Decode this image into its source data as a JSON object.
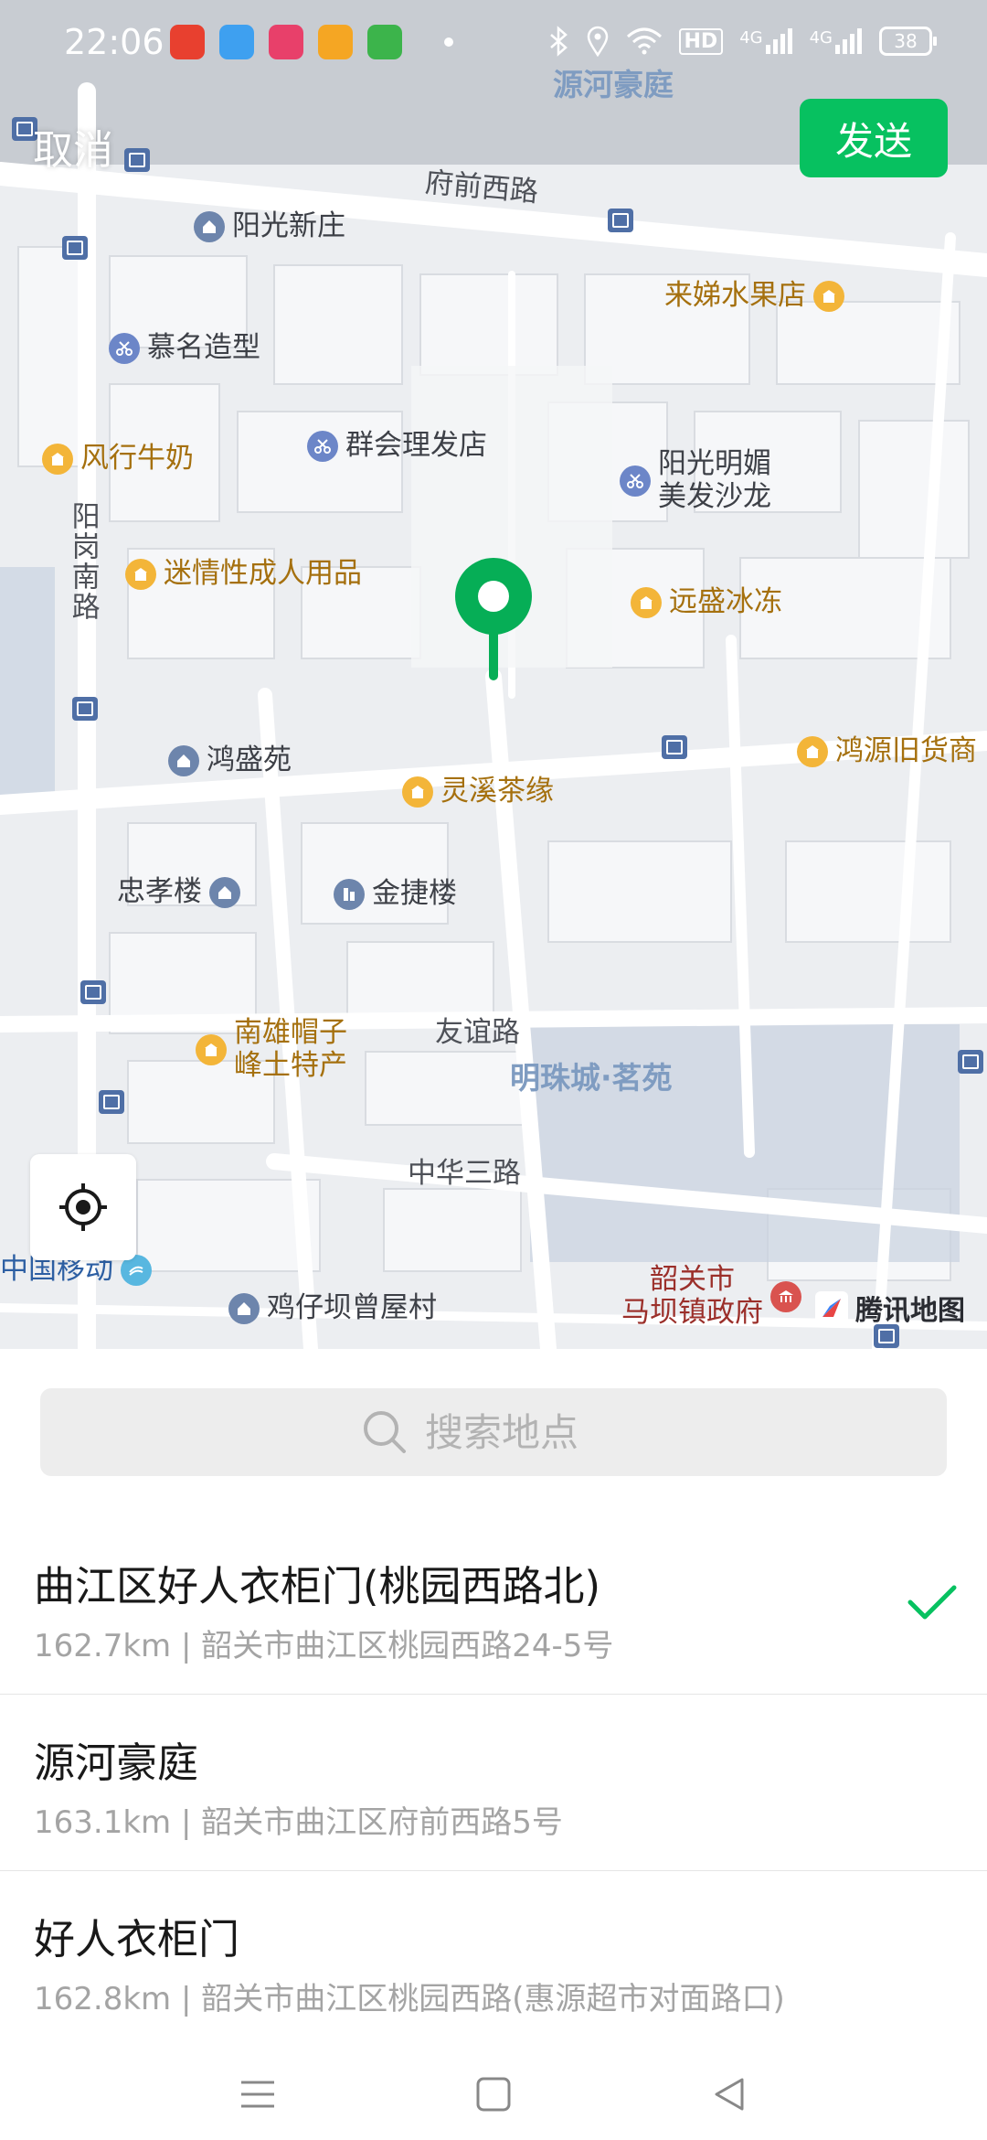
{
  "status_bar": {
    "time": "22:06",
    "battery": "38",
    "signal_1": "4G",
    "signal_2": "4G",
    "hd": "HD"
  },
  "header": {
    "cancel_label": "取消",
    "send_label": "发送"
  },
  "map": {
    "area_labels": {
      "yuanhe": "源河豪庭",
      "mingzhu": "明珠城·茗苑"
    },
    "roads": {
      "fuqian": "府前西路",
      "yanggang": "阳岗南路",
      "youyi": "友谊路",
      "zhonghua": "中华三路"
    },
    "pois": {
      "yangguang": "阳光新庄",
      "laiti": "来娣水果店",
      "muming": "慕名造型",
      "qunhui": "群会理发店",
      "fengxing": "风行牛奶",
      "yangguang_salon_1": "阳光明媚",
      "yangguang_salon_2": "美发沙龙",
      "mi": "迷情性成人用品",
      "yuansheng": "远盛冰冻",
      "hongsheng": "鸿盛苑",
      "lingxi": "灵溪茶缘",
      "hongyuan": "鸿源旧货商",
      "zhongxiao": "忠孝楼",
      "jinjie": "金捷楼",
      "nanxiong_1": "南雄帽子",
      "nanxiong_2": "峰土特产",
      "mobile": "中国移动",
      "jizai": "鸡仔坝曾屋村",
      "gov_1": "韶关市",
      "gov_2": "马坝镇政府"
    },
    "watermark": "腾讯地图"
  },
  "search": {
    "placeholder": "搜索地点"
  },
  "results": [
    {
      "name": "曲江区好人衣柜门(桃园西路北)",
      "detail": "162.7km | 韶关市曲江区桃园西路24-5号",
      "selected": true
    },
    {
      "name": "源河豪庭",
      "detail": "163.1km | 韶关市曲江区府前西路5号",
      "selected": false
    },
    {
      "name": "好人衣柜门",
      "detail": "162.8km | 韶关市曲江区桃园西路(惠源超市对面路口)",
      "selected": false
    }
  ],
  "colors": {
    "accent": "#07c160",
    "pin": "#06ae56",
    "poi_orange": "#f3b539",
    "poi_blue": "#6c86c8"
  },
  "icons": {
    "search": "search-icon",
    "check": "check-icon",
    "locate": "locate-icon",
    "pin": "map-pin-icon"
  }
}
